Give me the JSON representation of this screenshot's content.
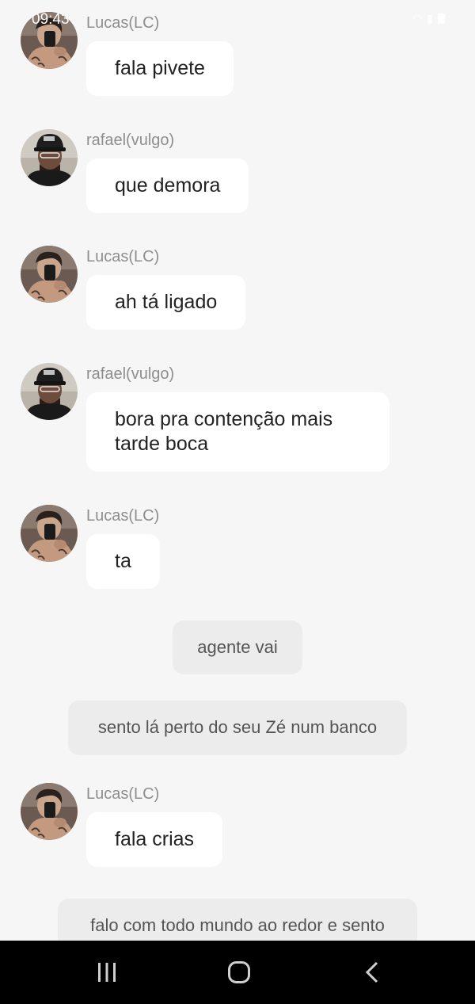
{
  "status_bar": {
    "time": "09:43",
    "icons": [
      "wifi-icon",
      "signal-icon",
      "battery-icon"
    ]
  },
  "messages": [
    {
      "type": "incoming",
      "sender": "Lucas(LC)",
      "avatar": "lucas-avatar",
      "text": "fala pivete"
    },
    {
      "type": "incoming",
      "sender": "rafael(vulgo)",
      "avatar": "rafael-avatar",
      "text": "que demora"
    },
    {
      "type": "incoming",
      "sender": "Lucas(LC)",
      "avatar": "lucas-avatar",
      "text": "ah tá ligado"
    },
    {
      "type": "incoming",
      "sender": "rafael(vulgo)",
      "avatar": "rafael-avatar",
      "text": "bora pra contenção mais tarde boca"
    },
    {
      "type": "incoming",
      "sender": "Lucas(LC)",
      "avatar": "lucas-avatar",
      "text": "ta"
    },
    {
      "type": "narration",
      "text": "agente vai"
    },
    {
      "type": "narration",
      "text": "sento lá perto do seu Zé num banco"
    },
    {
      "type": "incoming",
      "sender": "Lucas(LC)",
      "avatar": "lucas-avatar",
      "text": "fala crias"
    },
    {
      "type": "narration",
      "text": "falo com todo mundo ao redor e sento"
    }
  ],
  "nav_bar": {
    "buttons": [
      "recent-apps-icon",
      "home-icon",
      "back-icon"
    ]
  },
  "colors": {
    "background": "#f6f6f6",
    "bubble": "#ffffff",
    "narration_bubble": "#ececec",
    "sender_text": "#8e8e8e",
    "nav_bar": "#000000"
  }
}
